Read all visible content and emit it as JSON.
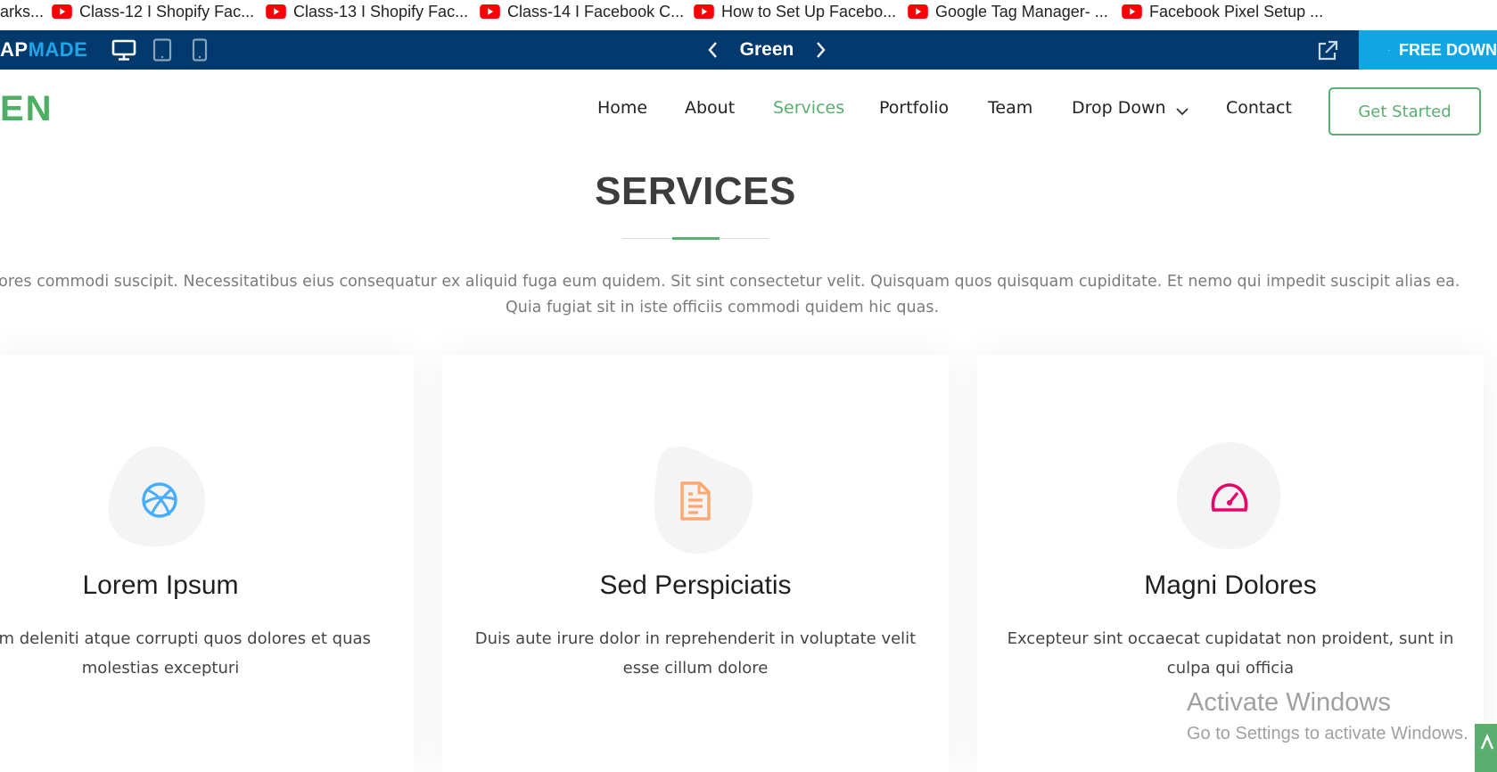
{
  "bookmarks": [
    {
      "label": "arks..."
    },
    {
      "label": "Class-12  I Shopify Fac..."
    },
    {
      "label": "Class-13  I Shopify Fac..."
    },
    {
      "label": "Class-14  I Facebook C..."
    },
    {
      "label": "How to Set Up Facebo..."
    },
    {
      "label": "Google Tag Manager- ..."
    },
    {
      "label": "Facebook Pixel Setup ..."
    }
  ],
  "toolbar": {
    "logo_part_a": "AP",
    "logo_part_b": "MADE",
    "theme_name": "Green",
    "download_label": "FREE DOWN"
  },
  "site": {
    "brand": "EN",
    "nav": [
      "Home",
      "About",
      "Services",
      "Portfolio",
      "Team",
      "Drop Down",
      "Contact"
    ],
    "active_nav": "Services",
    "cta_label": "Get Started"
  },
  "section": {
    "title": "SERVICES",
    "desc_line1": "olores commodi suscipit. Necessitatibus eius consequatur ex aliquid fuga eum quidem. Sit sint consectetur velit. Quisquam quos quisquam cupiditate. Et nemo qui impedit suscipit alias ea.",
    "desc_line2": "Quia fugiat sit in iste officiis commodi quidem hic quas."
  },
  "cards": [
    {
      "icon": "dribbble-icon",
      "icon_color": "#47aeff",
      "title": "Lorem Ipsum",
      "text_line1": "tum deleniti atque corrupti quos dolores et quas",
      "text_line2": "molestias excepturi"
    },
    {
      "icon": "file-text-icon",
      "icon_color": "#ffa76e",
      "title": "Sed Perspiciatis",
      "text_line1": "Duis aute irure dolor in reprehenderit in voluptate velit",
      "text_line2": "esse cillum dolore"
    },
    {
      "icon": "speedometer-icon",
      "icon_color": "#e80368",
      "title": "Magni Dolores",
      "text_line1": "Excepteur sint occaecat cupidatat non proident, sunt in",
      "text_line2": "culpa qui officia"
    }
  ],
  "watermark": {
    "line1": "Activate Windows",
    "line2": "Go to Settings to activate Windows."
  },
  "colors": {
    "toolbar_bg": "#023a6e",
    "download_bg": "#12a5e4",
    "accent_green": "#5aae70"
  }
}
